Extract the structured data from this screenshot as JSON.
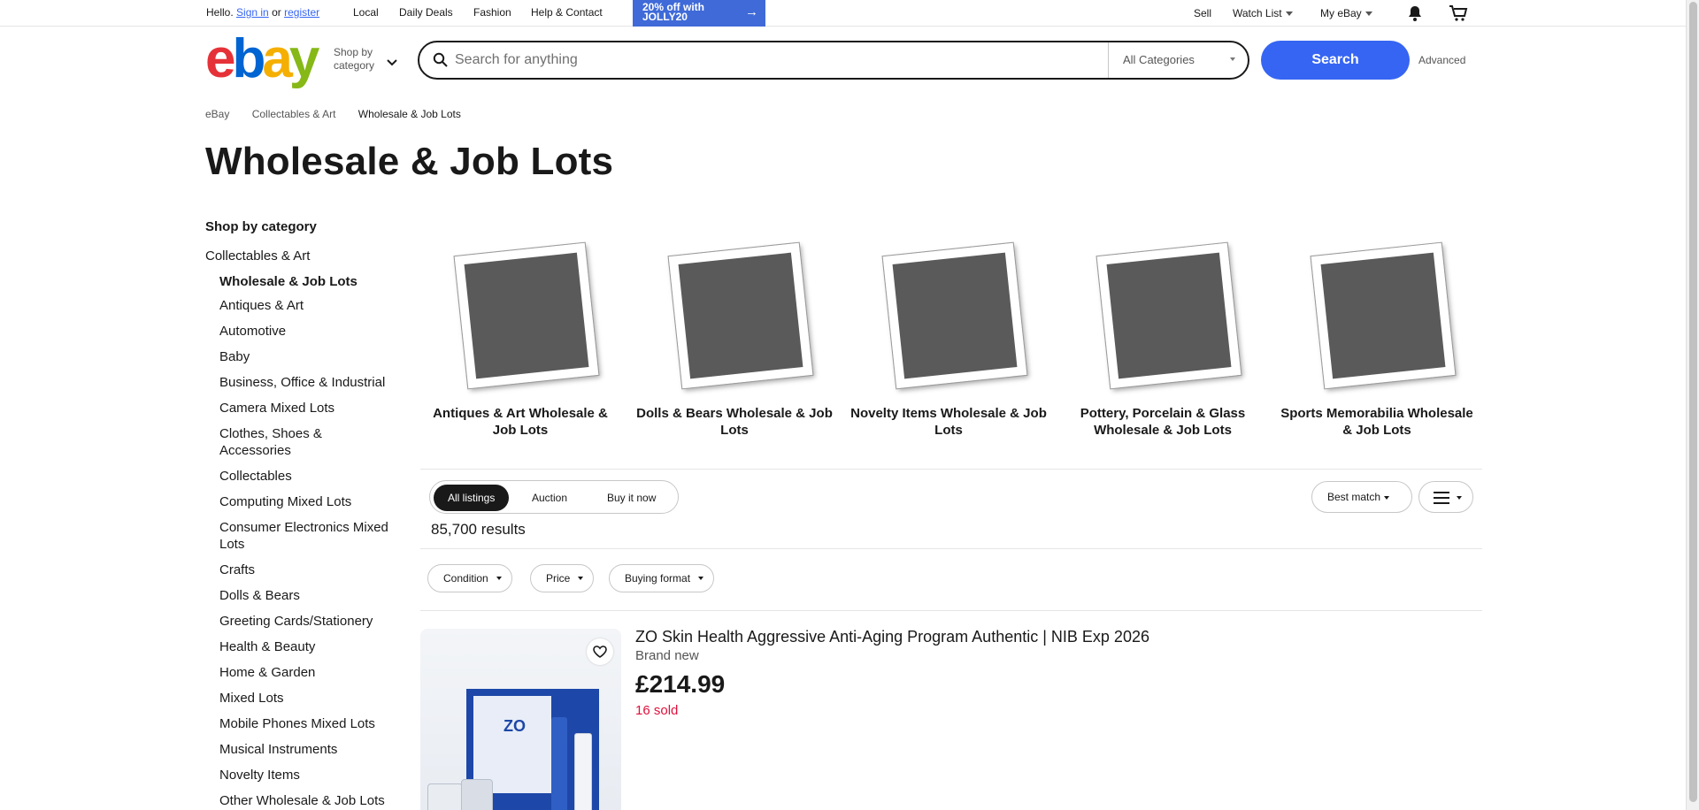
{
  "topbar": {
    "hello": "Hello.",
    "sign_in": "Sign in",
    "or": "or",
    "register": "register",
    "links": [
      "Local",
      "Daily Deals",
      "Fashion",
      "Help & Contact"
    ],
    "promo": "20% off with JOLLY20",
    "sell": "Sell",
    "watch_list": "Watch List",
    "my_ebay": "My eBay"
  },
  "header": {
    "logo_letters": [
      "e",
      "b",
      "a",
      "y"
    ],
    "shop_by": "Shop by",
    "category": "category",
    "search_placeholder": "Search for anything",
    "category_select": "All Categories",
    "search_button": "Search",
    "advanced": "Advanced"
  },
  "breadcrumb": [
    "eBay",
    "Collectables & Art",
    "Wholesale & Job Lots"
  ],
  "page_title": "Wholesale & Job Lots",
  "sidebar": {
    "heading": "Shop by category",
    "parent": "Collectables & Art",
    "current": "Wholesale & Job Lots",
    "items": [
      "Antiques & Art",
      "Automotive",
      "Baby",
      "Business, Office & Industrial",
      "Camera Mixed Lots",
      "Clothes, Shoes & Accessories",
      "Collectables",
      "Computing Mixed Lots",
      "Consumer Electronics Mixed Lots",
      "Crafts",
      "Dolls & Bears",
      "Greeting Cards/Stationery",
      "Health & Beauty",
      "Home & Garden",
      "Mixed Lots",
      "Mobile Phones Mixed Lots",
      "Musical Instruments",
      "Novelty Items",
      "Other Wholesale & Job Lots"
    ]
  },
  "tiles": [
    "Antiques & Art Wholesale & Job Lots",
    "Dolls & Bears Wholesale & Job Lots",
    "Novelty Items Wholesale & Job Lots",
    "Pottery, Porcelain & Glass Wholesale & Job Lots",
    "Sports Memorabilia Wholesale & Job Lots"
  ],
  "listing_tabs": [
    "All listings",
    "Auction",
    "Buy it now"
  ],
  "sort": "Best match",
  "results": "85,700 results",
  "filters": [
    "Condition",
    "Price",
    "Buying format"
  ],
  "item": {
    "image_text": "ZO",
    "title": "ZO Skin Health Aggressive Anti-Aging Program Authentic | NIB Exp 2026",
    "condition": "Brand new",
    "price": "£214.99",
    "sold": "16 sold"
  },
  "colors": {
    "accent": "#3665f3",
    "promo": "#3f6ad8",
    "sold": "#e0103a"
  },
  "icons": [
    "search-icon",
    "notification-bell-icon",
    "cart-icon",
    "heart-icon",
    "list-view-icon",
    "chevron-down-icon",
    "arrow-right-icon"
  ]
}
